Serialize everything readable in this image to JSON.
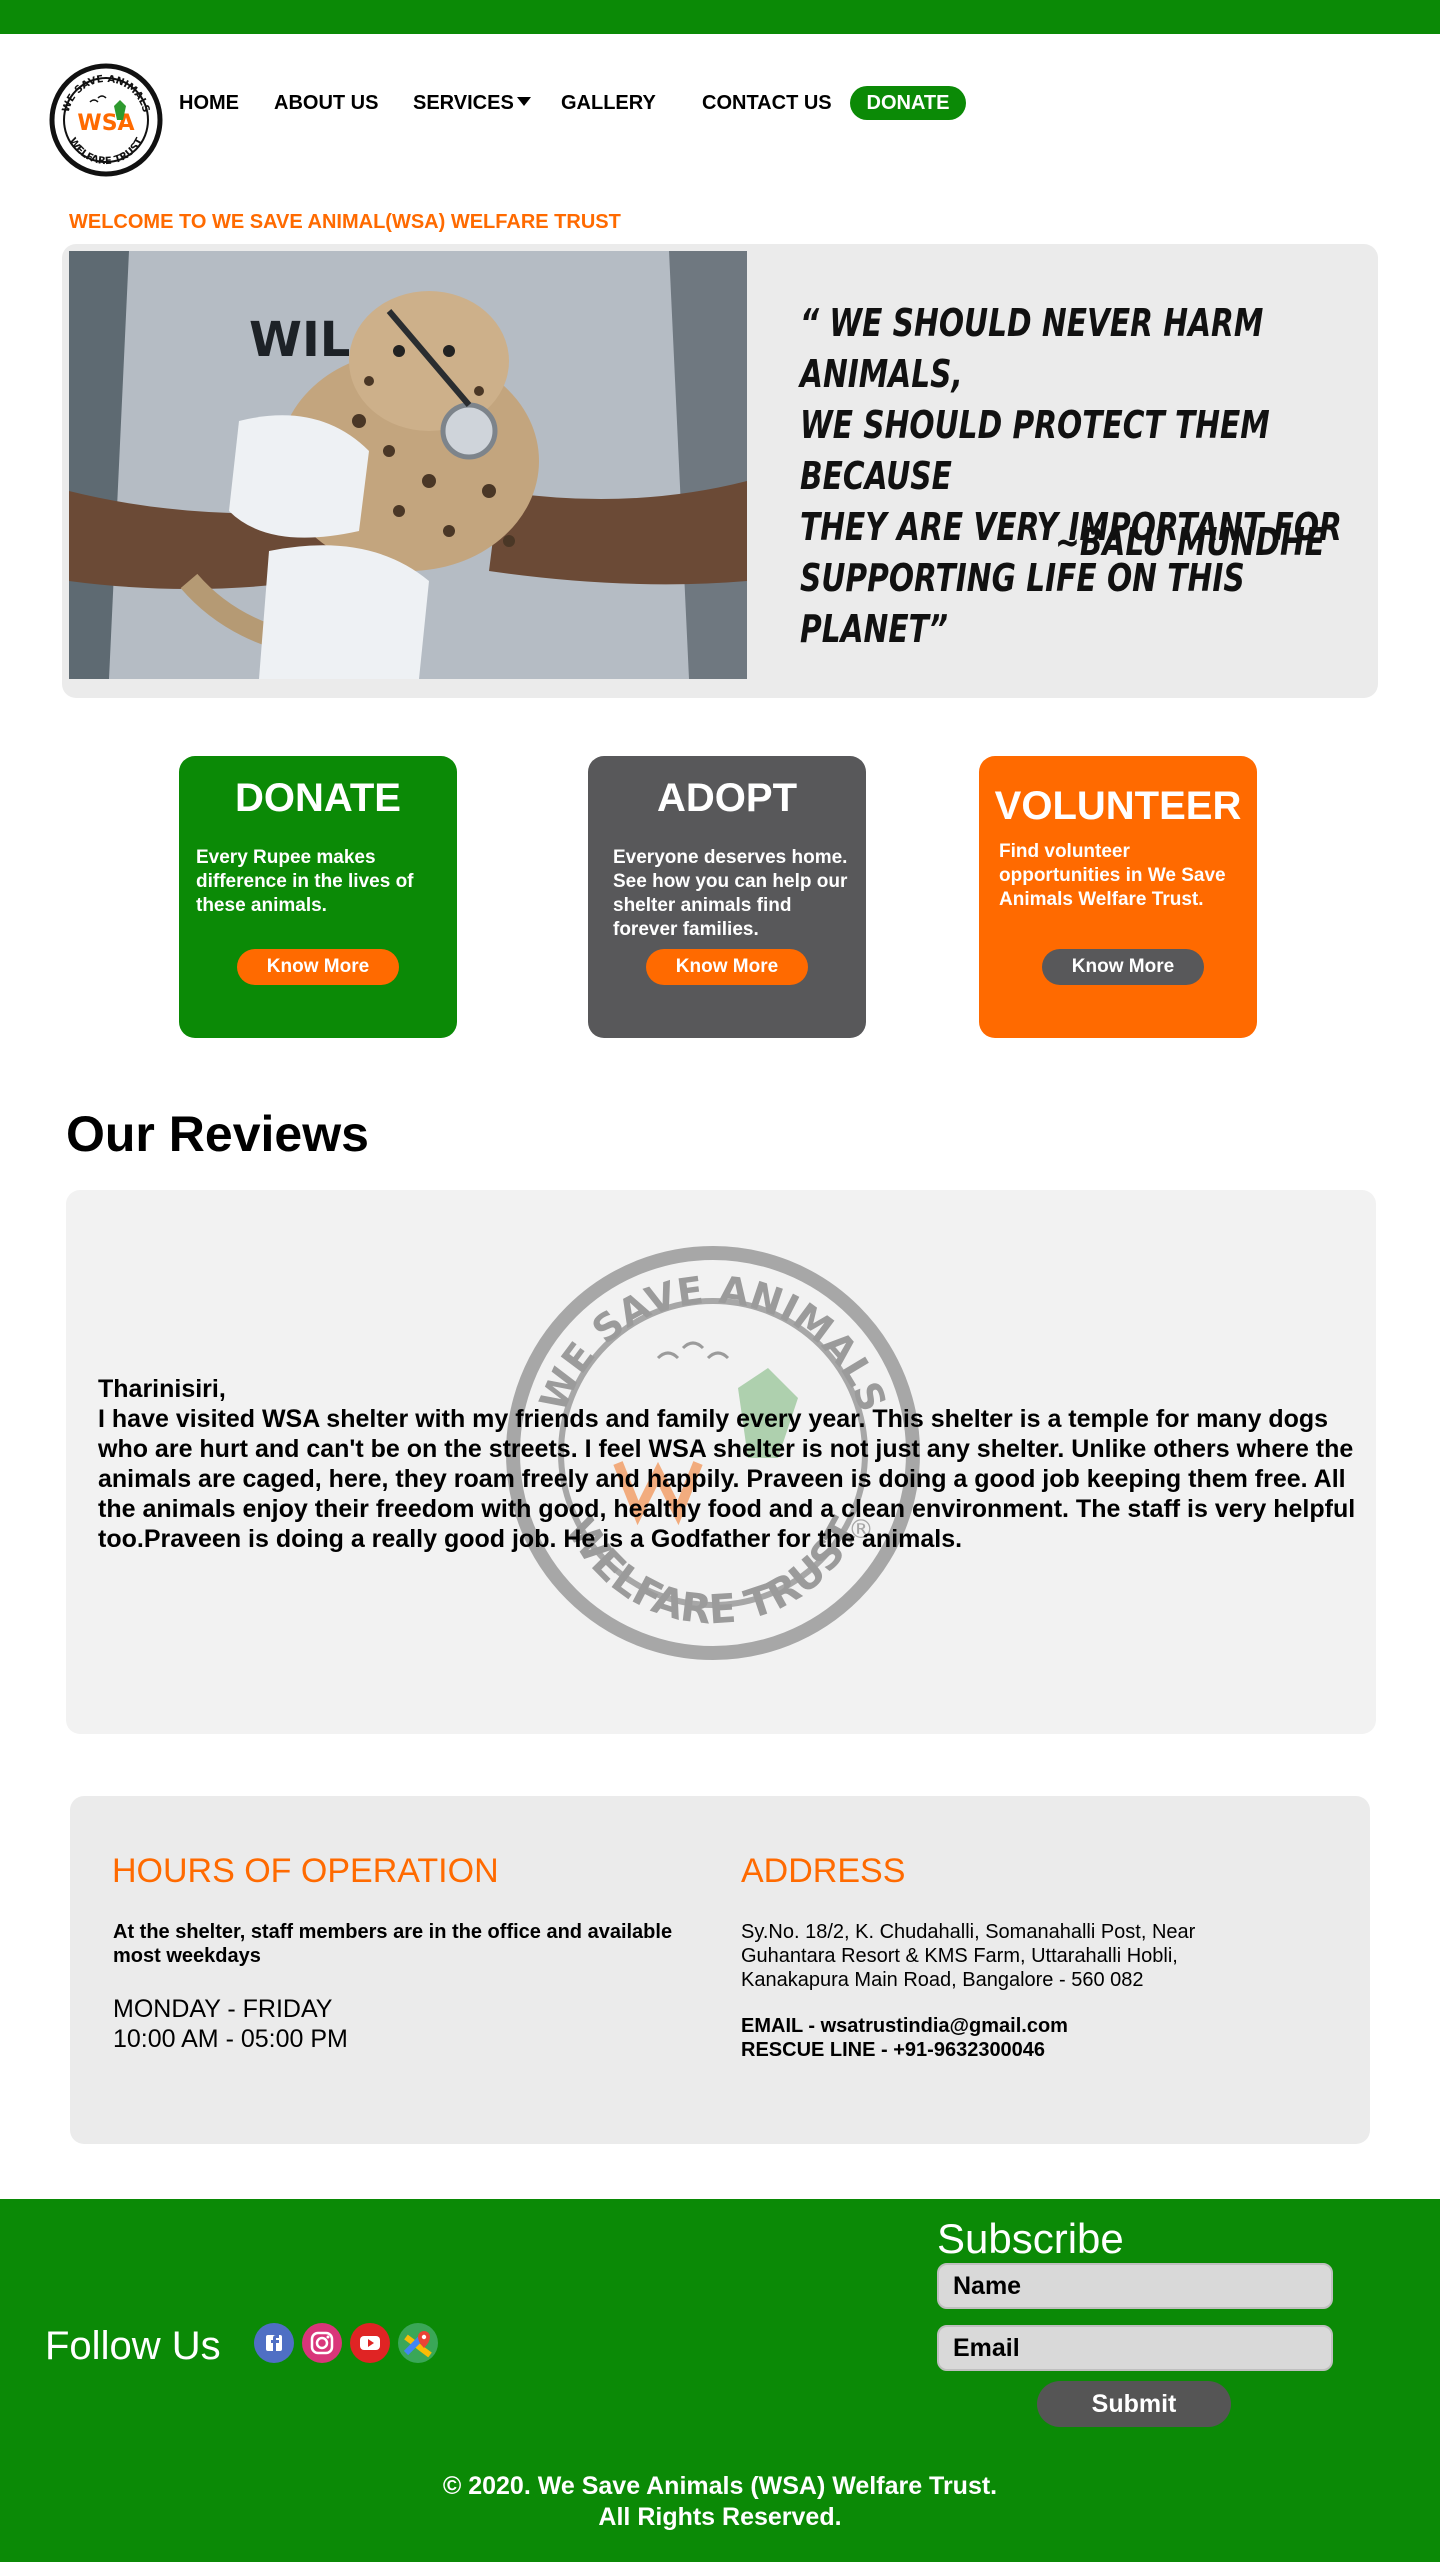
{
  "colors": {
    "brand_green": "#0b8a06",
    "accent_orange": "#ff6a00",
    "card_gray": "#58585a"
  },
  "logo": {
    "top_text": "WE SAVE ANIMALS",
    "mid_text": "WSA",
    "bottom_text": "WELFARE TRUST"
  },
  "nav": {
    "home": "HOME",
    "about": "ABOUT US",
    "services": "SERVICES",
    "gallery": "GALLERY",
    "contact": "CONTACT US",
    "donate": "DONATE"
  },
  "welcome": "WELCOME TO WE SAVE ANIMAL(WSA) WELFARE TRUST",
  "hero": {
    "quote_lines": [
      "“ WE SHOULD NEVER HARM ANIMALS,",
      "WE SHOULD PROTECT THEM BECAUSE",
      "THEY ARE VERY IMPORTANT FOR",
      "SUPPORTING LIFE ON THIS PLANET”"
    ],
    "author": "~BALU MUNDHE",
    "photo_shirt_text": "WIL"
  },
  "cards": {
    "donate": {
      "title": "DONATE",
      "text": "Every Rupee makes difference in the lives of these animals.",
      "button": "Know More"
    },
    "adopt": {
      "title": "ADOPT",
      "text": "Everyone deserves home. See how you can help our shelter animals find forever families.",
      "button": "Know More"
    },
    "volunteer": {
      "title": "VOLUNTEER",
      "text": "Find volunteer opportunities in We Save Animals Welfare Trust.",
      "button": "Know More"
    }
  },
  "reviews": {
    "title": "Our Reviews",
    "author": "Tharinisiri,",
    "text": "I have visited WSA shelter with my friends and family every year. This shelter is a temple for many dogs who are hurt and can't be on the streets. I feel WSA shelter is not just any shelter. Unlike others where the animals are caged, here, they roam freely and happily. Praveen is doing a good job keeping them free. All the animals enjoy their freedom with good, healthy food and a clean environment. The staff is very helpful too.Praveen is doing a really good job. He is a Godfather for the animals.",
    "watermark": {
      "top_text": "WE SAVE ANIMALS",
      "bottom_text": "WELFARE TRUST",
      "mark": "®"
    }
  },
  "hours": {
    "title": "HOURS OF OPERATION",
    "note": "At the shelter, staff members are in the office and available most weekdays",
    "days": "MONDAY - FRIDAY",
    "time": "10:00 AM - 05:00 PM"
  },
  "address": {
    "title": "ADDRESS",
    "text": "Sy.No. 18/2, K. Chudahalli, Somanahalli Post, Near Guhantara Resort & KMS Farm, Uttarahalli Hobli, Kanakapura Main Road, Bangalore - 560 082",
    "email": "EMAIL - wsatrustindia@gmail.com",
    "rescue": "RESCUE LINE - +91-9632300046"
  },
  "footer": {
    "follow": "Follow Us",
    "social_icons": [
      "facebook-icon",
      "instagram-icon",
      "youtube-icon",
      "maps-icon"
    ],
    "subscribe": "Subscribe",
    "name_placeholder": "Name",
    "email_placeholder": "Email",
    "submit": "Submit",
    "copyright_1": "© 2020. We Save Animals (WSA) Welfare Trust.",
    "copyright_2": "All Rights Reserved."
  }
}
